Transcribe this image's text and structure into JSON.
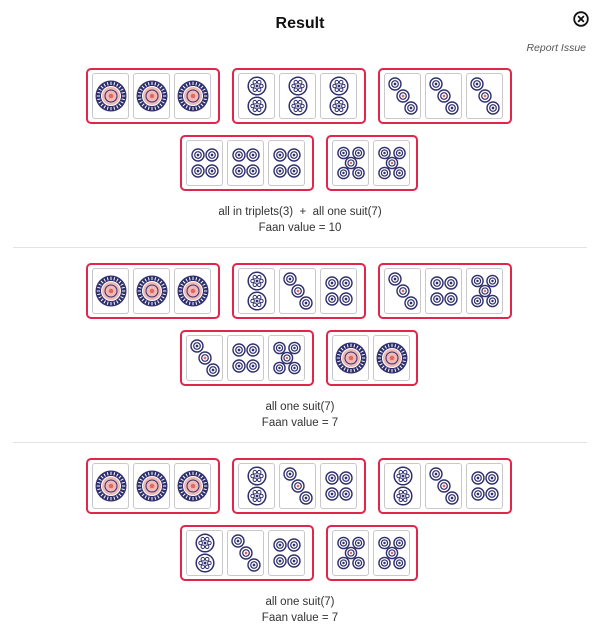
{
  "header": {
    "title": "Result",
    "report_label": "Report Issue"
  },
  "tile_symbols": {
    "1": "one-circle",
    "2": "two-circles",
    "3": "three-circles-diagonal",
    "4": "four-circles",
    "5": "five-circles"
  },
  "hands": [
    {
      "groups": [
        [
          1,
          1,
          1
        ],
        [
          2,
          2,
          2
        ],
        [
          3,
          3,
          3
        ],
        [
          4,
          4,
          4
        ],
        [
          5,
          5
        ]
      ],
      "pattern_text": "all in triplets(3)  +  all one suit(7)",
      "faan_text": "Faan value = 10"
    },
    {
      "groups": [
        [
          1,
          1,
          1
        ],
        [
          2,
          3,
          4
        ],
        [
          3,
          4,
          5
        ],
        [
          3,
          4,
          5
        ],
        [
          1,
          1
        ]
      ],
      "pattern_text": "all one suit(7)",
      "faan_text": "Faan value = 7"
    },
    {
      "groups": [
        [
          1,
          1,
          1
        ],
        [
          2,
          3,
          4
        ],
        [
          2,
          3,
          4
        ],
        [
          2,
          3,
          4
        ],
        [
          5,
          5
        ]
      ],
      "pattern_text": "all one suit(7)",
      "faan_text": "Faan value = 7"
    }
  ]
}
